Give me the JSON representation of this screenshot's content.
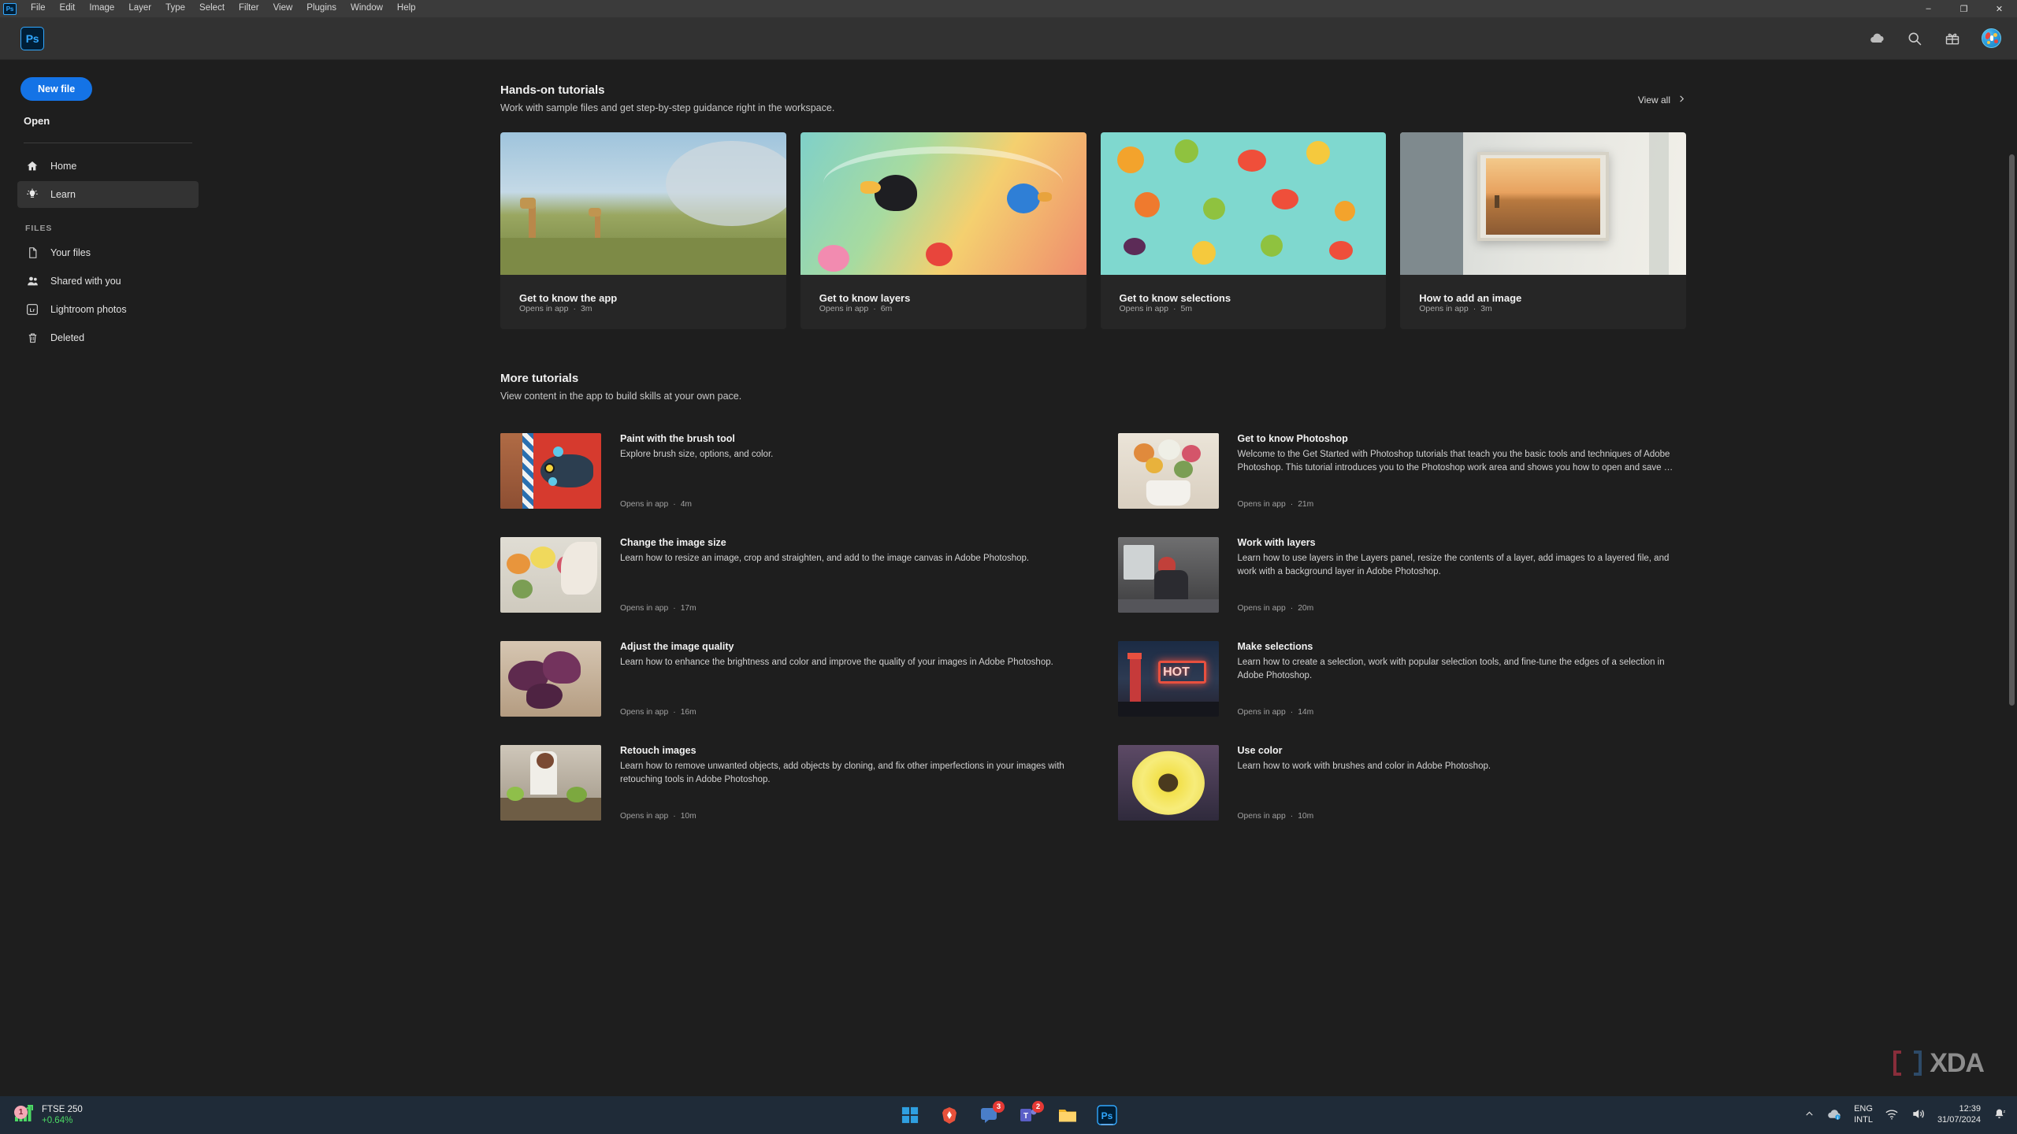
{
  "window": {
    "app_mini_logo": "Ps",
    "menu_items": [
      "File",
      "Edit",
      "Image",
      "Layer",
      "Type",
      "Select",
      "Filter",
      "View",
      "Plugins",
      "Window",
      "Help"
    ],
    "controls": {
      "minimize": "–",
      "maximize": "❐",
      "close": "✕"
    }
  },
  "header": {
    "logo": "Ps",
    "icons": [
      "cloud-icon",
      "search-icon",
      "gift-icon",
      "avatar"
    ]
  },
  "sidebar": {
    "new_file_label": "New file",
    "open_label": "Open",
    "nav": [
      {
        "label": "Home",
        "icon": "home-icon",
        "active": false
      },
      {
        "label": "Learn",
        "icon": "lightbulb-icon",
        "active": true
      }
    ],
    "files_section_label": "FILES",
    "files": [
      {
        "label": "Your files",
        "icon": "document-icon"
      },
      {
        "label": "Shared with you",
        "icon": "people-icon"
      },
      {
        "label": "Lightroom photos",
        "icon": "lightroom-icon"
      },
      {
        "label": "Deleted",
        "icon": "trash-icon"
      }
    ]
  },
  "hands_on": {
    "title": "Hands-on tutorials",
    "subtitle": "Work with sample files and get step-by-step guidance right in the workspace.",
    "view_all_label": "View all",
    "cards": [
      {
        "title": "Get to know the app",
        "opens": "Opens in app",
        "duration": "3m",
        "thumb": "giraffes-savanna"
      },
      {
        "title": "Get to know layers",
        "opens": "Opens in app",
        "duration": "6m",
        "thumb": "tropical-birds"
      },
      {
        "title": "Get to know selections",
        "opens": "Opens in app",
        "duration": "5m",
        "thumb": "fruit-pattern"
      },
      {
        "title": "How to add an image",
        "opens": "Opens in app",
        "duration": "3m",
        "thumb": "framed-art-wall"
      }
    ]
  },
  "more_tutorials": {
    "title": "More tutorials",
    "subtitle": "View content in the app to build skills at your own pace.",
    "items": [
      {
        "title": "Paint with the brush tool",
        "desc": "Explore brush size, options, and color.",
        "opens": "Opens in app",
        "duration": "4m",
        "thumb": "fish-painting"
      },
      {
        "title": "Get to know Photoshop",
        "desc": "Welcome to the Get Started with Photoshop tutorials that teach you the basic tools and techniques of Adobe Photoshop. This tutorial introduces you to the Photoshop work area and shows you how to open and save …",
        "opens": "Opens in app",
        "duration": "21m",
        "thumb": "flower-bouquet"
      },
      {
        "title": "Change the image size",
        "desc": "Learn how to resize an image, crop and straighten, and add to the image canvas in Adobe Photoshop.",
        "opens": "Opens in app",
        "duration": "17m",
        "thumb": "florist-hands"
      },
      {
        "title": "Work with layers",
        "desc": "Learn how to use layers in the Layers panel, resize the contents of a layer, add images to a layered file, and work with a background layer in Adobe Photoshop.",
        "opens": "Opens in app",
        "duration": "20m",
        "thumb": "person-desk"
      },
      {
        "title": "Adjust the image quality",
        "desc": "Learn how to enhance the brightness and color and improve the quality of your images in Adobe Photoshop.",
        "opens": "Opens in app",
        "duration": "16m",
        "thumb": "purple-callas"
      },
      {
        "title": "Make selections",
        "desc": "Learn how to create a selection, work with popular selection tools, and fine-tune the edges of a selection in Adobe Photoshop.",
        "opens": "Opens in app",
        "duration": "14m",
        "thumb": "neon-hot-sign"
      },
      {
        "title": "Retouch images",
        "desc": "Learn how to remove unwanted objects, add objects by cloning, and fix other imperfections in your images with retouching tools in Adobe Photoshop.",
        "opens": "Opens in app",
        "duration": "10m",
        "thumb": "market-vendor"
      },
      {
        "title": "Use color",
        "desc": "Learn how to work with brushes and color in Adobe Photoshop.",
        "opens": "Opens in app",
        "duration": "10m",
        "thumb": "yellow-dahlia"
      }
    ]
  },
  "taskbar": {
    "stock_name": "FTSE 250",
    "stock_change": "+0.64%",
    "stock_badge": "1",
    "apps": [
      {
        "name": "windows-start",
        "badge": ""
      },
      {
        "name": "brave-browser",
        "badge": ""
      },
      {
        "name": "chat-app",
        "badge": "3"
      },
      {
        "name": "teams-app",
        "badge": "2"
      },
      {
        "name": "file-explorer",
        "badge": ""
      },
      {
        "name": "photoshop-app",
        "badge": ""
      }
    ],
    "language_line1": "ENG",
    "language_line2": "INTL",
    "time": "12:39",
    "date": "31/07/2024"
  },
  "watermark": "XDA",
  "colors": {
    "accent_blue": "#1473e6",
    "ps_blue": "#31a8ff",
    "bg": "#1e1e1e",
    "header_bg": "#323232",
    "card_bg": "#262626",
    "taskbar_bg": "#1f2b38",
    "stock_green": "#4cd964"
  }
}
